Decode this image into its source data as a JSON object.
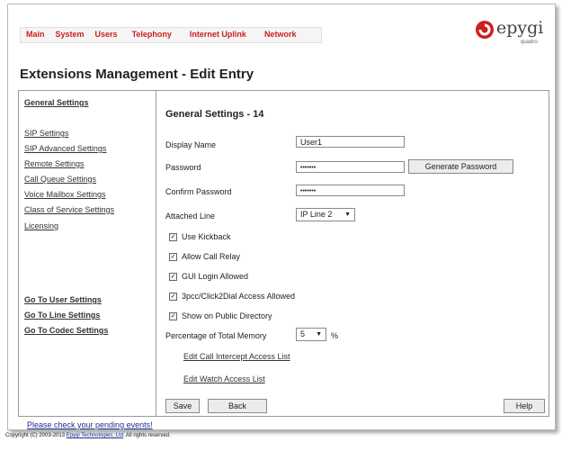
{
  "nav": {
    "items": [
      "Main",
      "System",
      "Users",
      "Telephony",
      "Internet Uplink",
      "Network"
    ]
  },
  "logo": {
    "text": "epygi",
    "sub": "quadro"
  },
  "page_title": "Extensions Management - Edit Entry",
  "sidebar": {
    "items": [
      "General Settings",
      "SIP Settings",
      "SIP Advanced Settings",
      "Remote Settings",
      "Call Queue Settings",
      "Voice Mailbox Settings",
      "Class of Service Settings",
      "Licensing"
    ],
    "goto": [
      "Go To User Settings",
      "Go To Line Settings",
      "Go To Codec Settings"
    ]
  },
  "form": {
    "section_title": "General Settings - 14",
    "display_name_label": "Display Name",
    "display_name_value": "User1",
    "password_label": "Password",
    "password_value": "•••••••",
    "generate_password_button": "Generate Password",
    "confirm_password_label": "Confirm Password",
    "confirm_password_value": "•••••••",
    "attached_line_label": "Attached Line",
    "attached_line_value": "IP Line 2",
    "checkboxes": [
      "Use Kickback",
      "Allow Call Relay",
      "GUI Login Allowed",
      "3pcc/Click2Dial Access Allowed",
      "Show on Public Directory"
    ],
    "memory_label": "Percentage of Total Memory",
    "memory_value": "5",
    "memory_unit": "%",
    "intercept_link": "Edit Call Intercept Access List",
    "watch_link": "Edit Watch Access List",
    "save_button": "Save",
    "back_button": "Back",
    "help_button": "Help"
  },
  "footer": {
    "pending_link": "Please check your pending events!",
    "copyright_prefix": "Copyright (C) 2003-2013 ",
    "copyright_company": "Epygi Technologies, Ltd",
    "copyright_suffix": ". All rights reserved."
  },
  "colors": {
    "nav_text": "#cc1f1f",
    "logo_red": "#cc1f1f",
    "link_blue": "#1f2f8f"
  }
}
